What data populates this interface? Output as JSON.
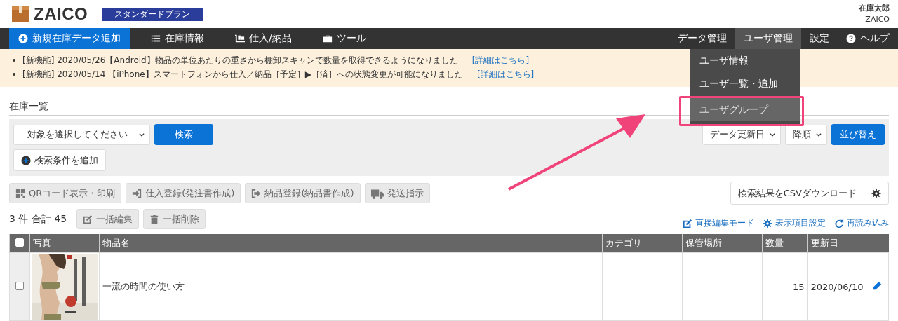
{
  "header": {
    "logo": "ZAICO",
    "plan": "スタンダードプラン",
    "user_name": "在庫太郎",
    "company": "ZAICO"
  },
  "nav": {
    "left": [
      {
        "label": "新規在庫データ追加",
        "kind": "primary"
      },
      {
        "label": "在庫情報",
        "kind": "link"
      },
      {
        "label": "仕入/納品",
        "kind": "link"
      },
      {
        "label": "ツール",
        "kind": "link"
      }
    ],
    "right": [
      {
        "label": "データ管理",
        "selected": false
      },
      {
        "label": "ユーザ管理",
        "selected": true
      },
      {
        "label": "設定",
        "selected": false
      },
      {
        "label": "ヘルプ",
        "selected": false
      }
    ]
  },
  "user_menu": {
    "expanded": true,
    "items": [
      {
        "label": "ユーザ情報",
        "selected": false
      },
      {
        "label": "ユーザ一覧・追加",
        "selected": false
      },
      {
        "label": "ユーザグループ",
        "selected": true
      }
    ]
  },
  "notices": [
    {
      "text": "[新機能] 2020/05/26【Android】物品の単位あたりの重さから棚卸スキャンで数量を取得できるようになりました",
      "link": "[詳細はこちら]"
    },
    {
      "text": "[新機能] 2020/05/14 【iPhone】スマートフォンから仕入／納品［予定］▶［済］への状態変更が可能になりました",
      "link": "[詳細はこちら]"
    }
  ],
  "section_title": "在庫一覧",
  "search": {
    "target_select": "- 対象を選択してください -",
    "search_button": "検索",
    "add_condition": "検索条件を追加",
    "sort_field": "データ更新日",
    "sort_order": "降順",
    "sort_button": "並び替え"
  },
  "actions": [
    "QRコード表示・印刷",
    "仕入登録(発注書作成)",
    "納品登録(納品書作成)",
    "発送指示"
  ],
  "csv_button": "検索結果をCSVダウンロード",
  "summary": "3 件 合計 45",
  "bulk_actions": [
    "一括編集",
    "一括削除"
  ],
  "view_links": [
    "直接編集モード",
    "表示項目設定",
    "再読み込み"
  ],
  "table": {
    "header_checked": false,
    "columns": [
      "写真",
      "物品名",
      "カテゴリ",
      "保管場所",
      "数量",
      "更新日"
    ],
    "rows": [
      {
        "checked": false,
        "name": "一流の時間の使い方",
        "category": "",
        "location": "",
        "quantity": "15",
        "updated": "2020/06/10"
      }
    ]
  }
}
